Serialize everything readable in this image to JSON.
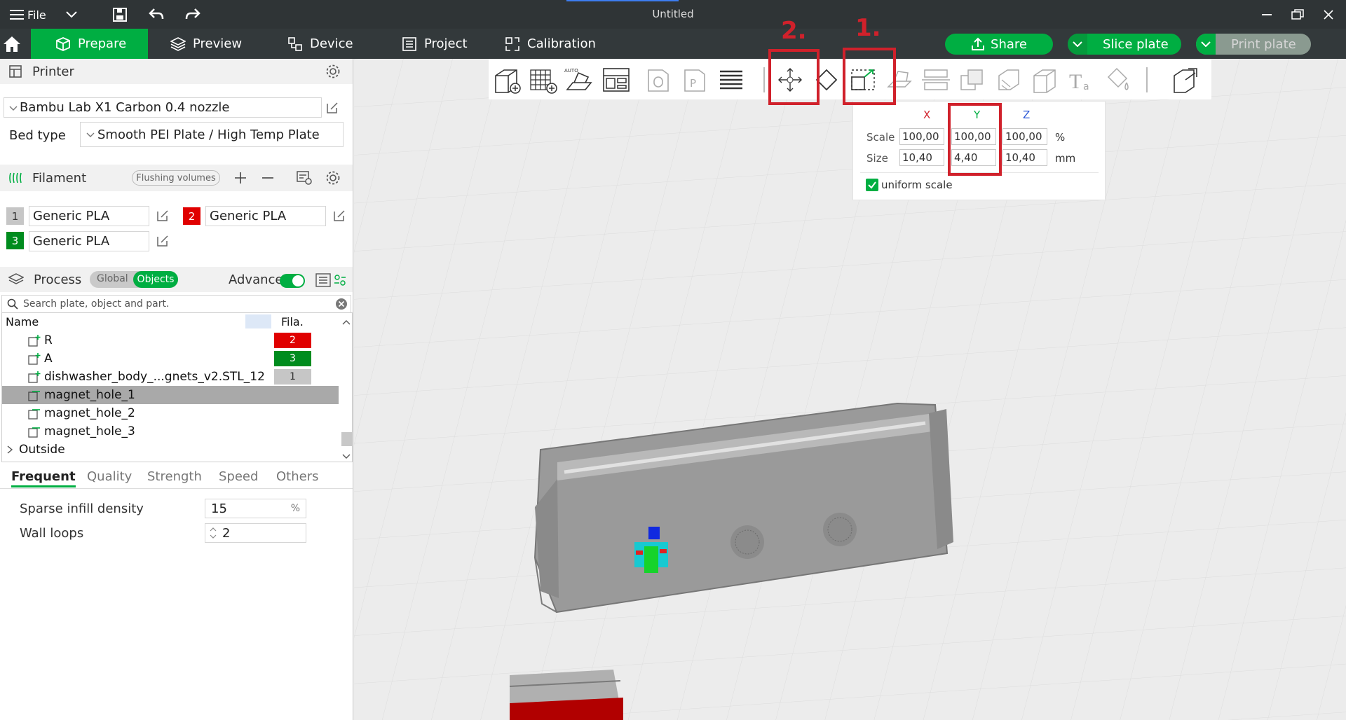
{
  "window": {
    "title": "Untitled",
    "file_menu": "File"
  },
  "tabs": [
    {
      "label": "Prepare"
    },
    {
      "label": "Preview"
    },
    {
      "label": "Device"
    },
    {
      "label": "Project"
    },
    {
      "label": "Calibration"
    }
  ],
  "actions": {
    "share": "Share",
    "slice": "Slice plate",
    "print": "Print plate"
  },
  "printer": {
    "header": "Printer",
    "model": "Bambu Lab X1 Carbon 0.4 nozzle",
    "bed_label": "Bed type",
    "bed_value": "Smooth PEI Plate / High Temp Plate"
  },
  "filament": {
    "header": "Filament",
    "flushing": "Flushing volumes",
    "items": [
      {
        "num": "1",
        "name": "Generic PLA",
        "color": "#c6c6c6"
      },
      {
        "num": "2",
        "name": "Generic PLA",
        "color": "#e00000"
      },
      {
        "num": "3",
        "name": "Generic PLA",
        "color": "#008c1e"
      }
    ]
  },
  "process": {
    "header": "Process",
    "global": "Global",
    "objects": "Objects",
    "advance": "Advance"
  },
  "search": {
    "placeholder": "Search plate, object and part."
  },
  "objects": {
    "col_name": "Name",
    "col_fila": "Fila.",
    "rows": [
      {
        "name": "R",
        "fila": "2",
        "color": "#e00000"
      },
      {
        "name": "A",
        "fila": "3",
        "color": "#008c1e"
      },
      {
        "name": "dishwasher_body_...gnets_v2.STL_12",
        "fila": "1",
        "color": "#c6c6c6"
      },
      {
        "name": "magnet_hole_1",
        "fila": "",
        "color": ""
      },
      {
        "name": "magnet_hole_2",
        "fila": "",
        "color": ""
      },
      {
        "name": "magnet_hole_3",
        "fila": "",
        "color": ""
      },
      {
        "name": "Outside",
        "fila": "",
        "color": ""
      }
    ]
  },
  "proc_tabs": [
    "Frequent",
    "Quality",
    "Strength",
    "Speed",
    "Others"
  ],
  "settings": {
    "infill_label": "Sparse infill density",
    "infill_value": "15",
    "infill_unit": "%",
    "wall_label": "Wall loops",
    "wall_value": "2"
  },
  "scale": {
    "x": "X",
    "y": "Y",
    "z": "Z",
    "scale_label": "Scale",
    "size_label": "Size",
    "scale_x": "100,00",
    "scale_y": "100,00",
    "scale_z": "100,00",
    "scale_unit": "%",
    "size_x": "10,40",
    "size_y": "4,40",
    "size_z": "10,40",
    "size_unit": "mm",
    "uniform": "uniform scale"
  },
  "annotations": {
    "one": "1.",
    "two": "2."
  }
}
